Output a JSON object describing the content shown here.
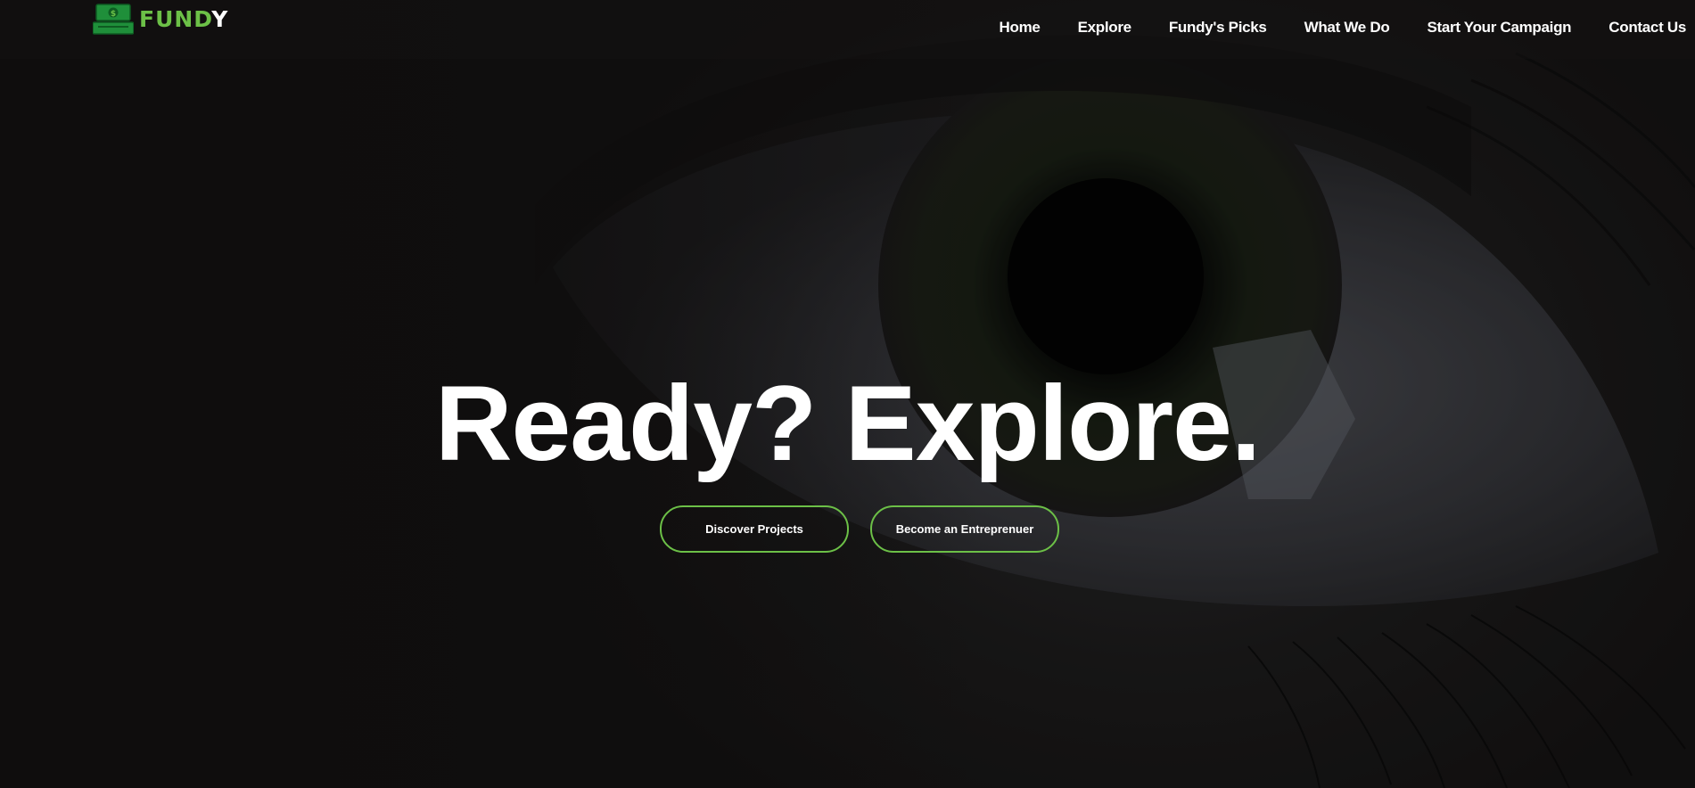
{
  "brand": {
    "name_main": "FUND",
    "name_last": "Y",
    "logo_icon": "cash-register-icon",
    "accent_color": "#6cc047"
  },
  "nav": {
    "items": [
      {
        "label": "Home"
      },
      {
        "label": "Explore"
      },
      {
        "label": "Fundy's Picks"
      },
      {
        "label": "What We Do"
      },
      {
        "label": "Start Your Campaign"
      },
      {
        "label": "Contact Us"
      }
    ]
  },
  "hero": {
    "title": "Ready? Explore.",
    "background_image": "eye-closeup-image",
    "buttons": {
      "discover": "Discover Projects",
      "entrepreneur": "Become an Entreprenuer"
    }
  }
}
